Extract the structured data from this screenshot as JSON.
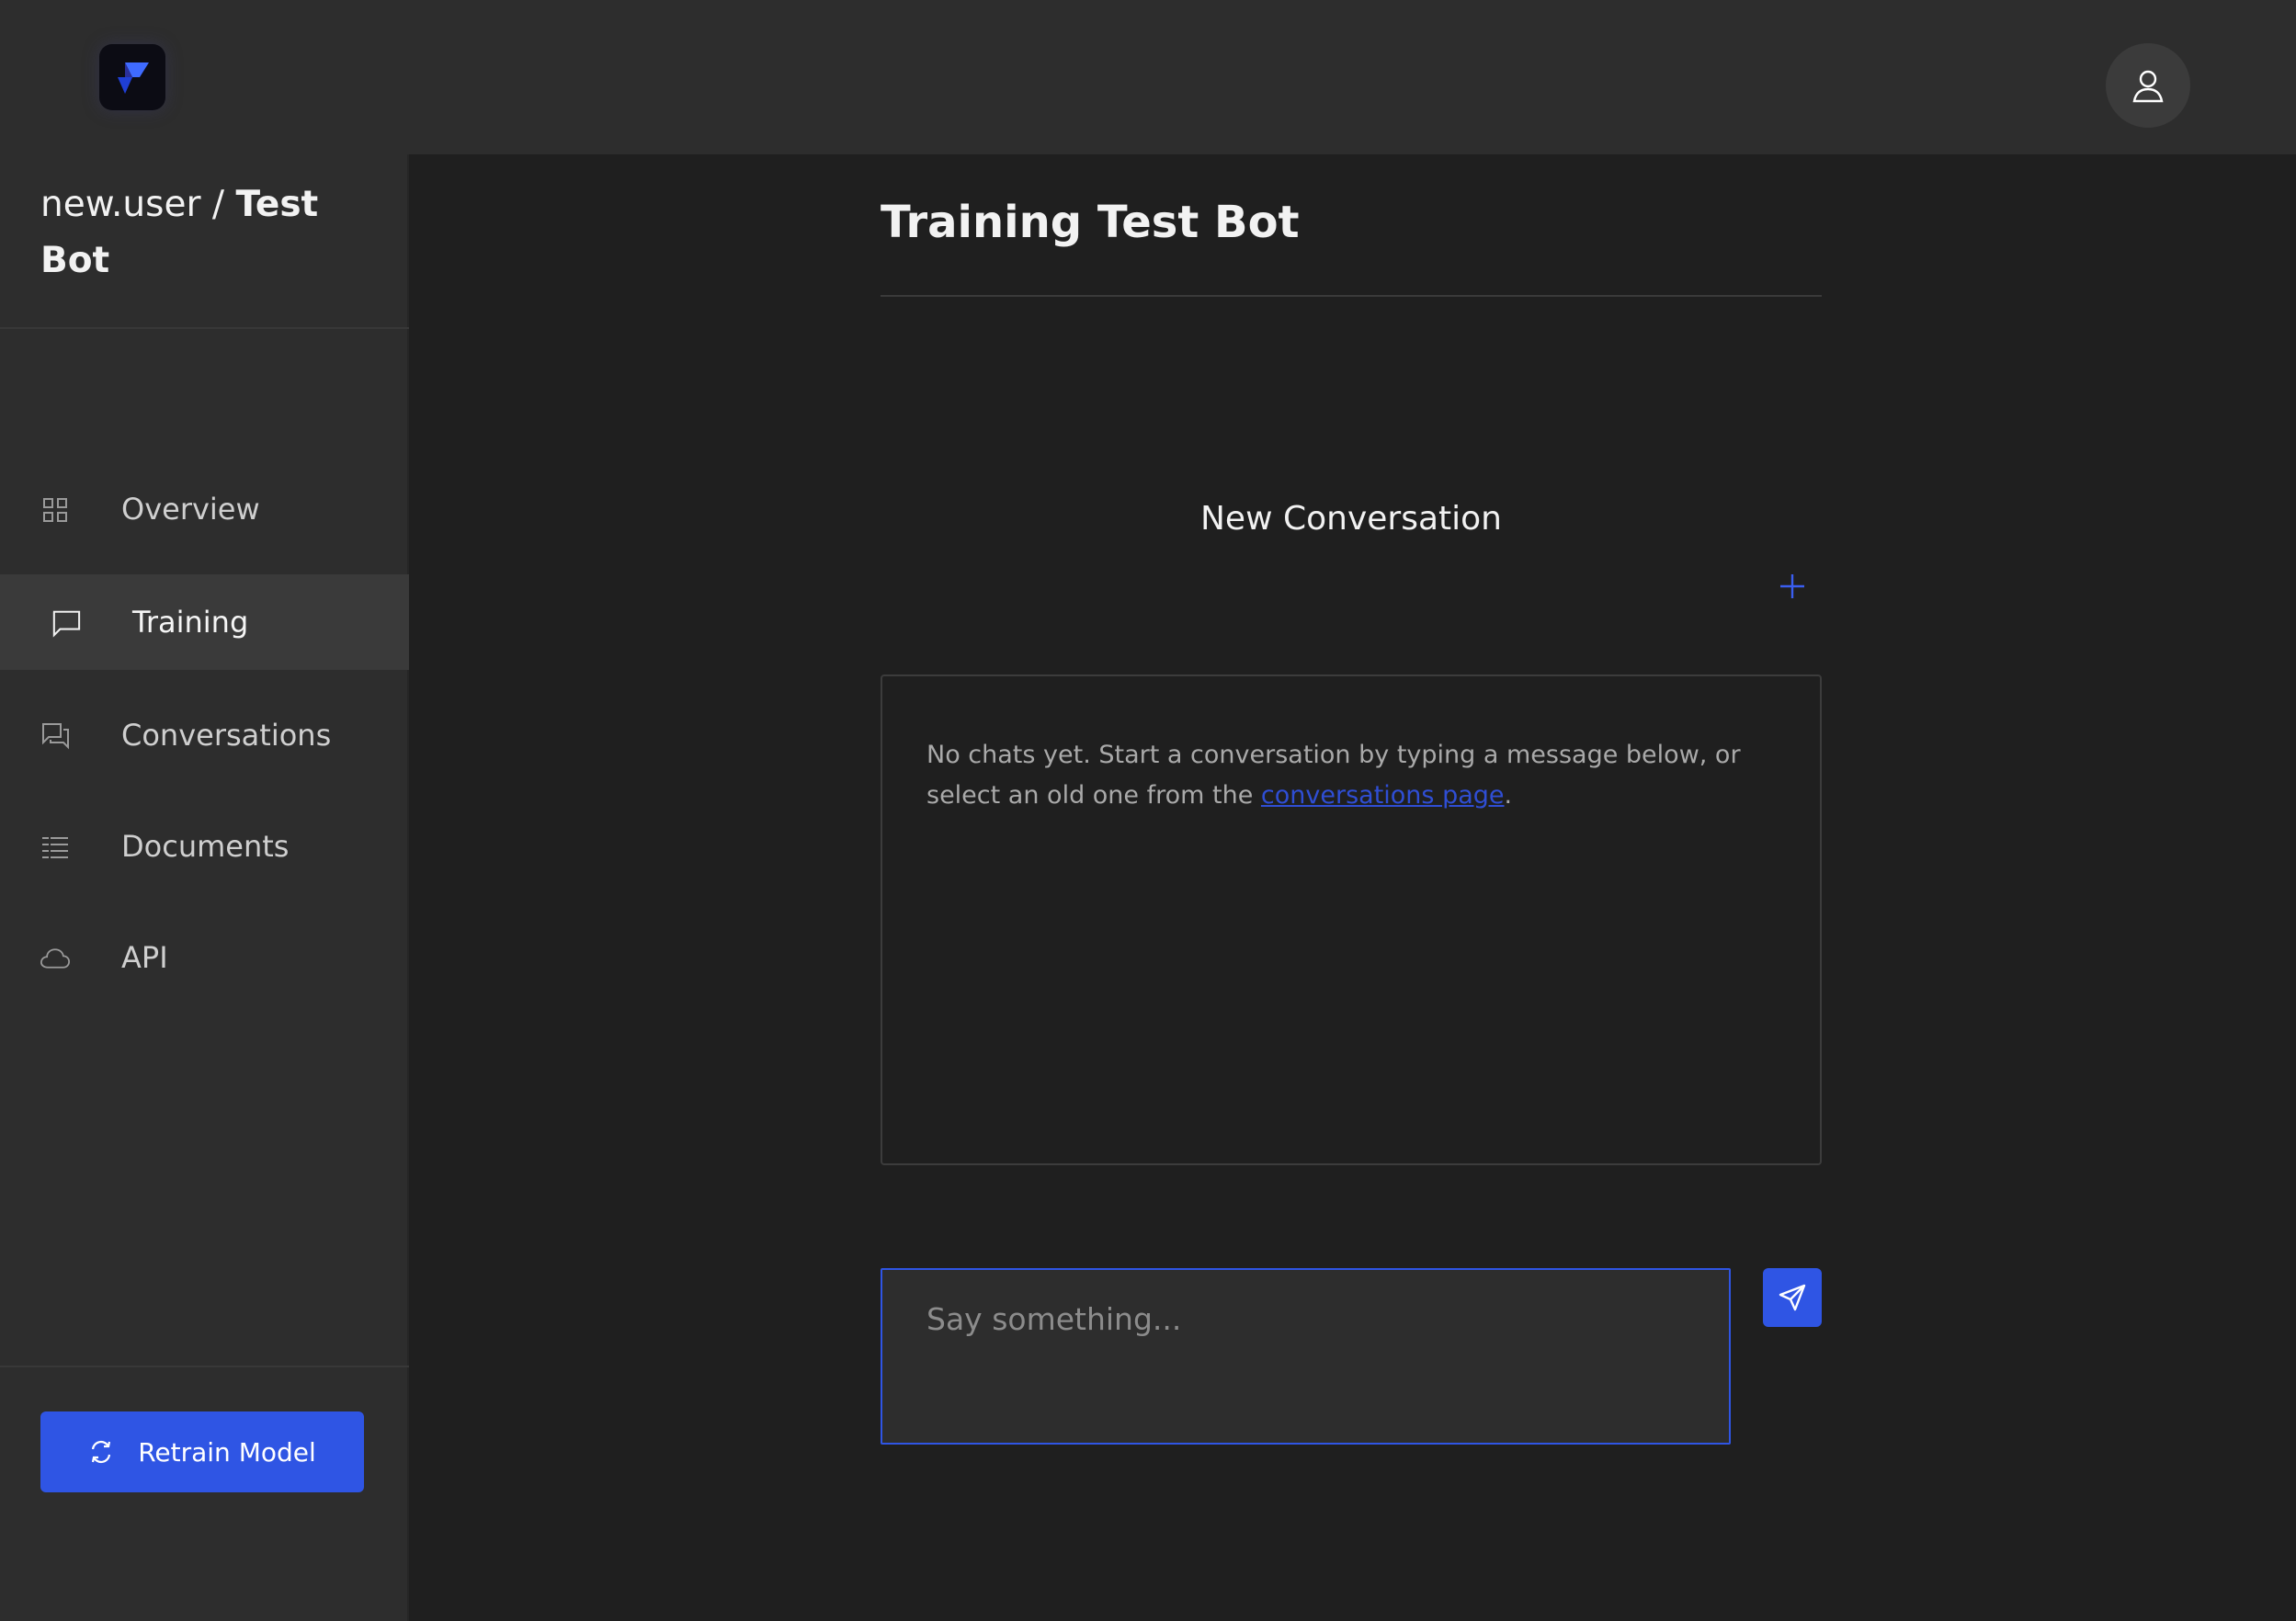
{
  "app": {
    "logo_icon": "app-logo-icon",
    "user_icon": "user-icon"
  },
  "breadcrumb": {
    "user": "new.user",
    "separator": "/",
    "bot": "Test Bot"
  },
  "sidebar": {
    "items": [
      {
        "label": "Overview",
        "icon": "grid-icon",
        "active": false
      },
      {
        "label": "Training",
        "icon": "chat-bubble-icon",
        "active": true
      },
      {
        "label": "Conversations",
        "icon": "conversations-icon",
        "active": false
      },
      {
        "label": "Documents",
        "icon": "documents-list-icon",
        "active": false
      },
      {
        "label": "API",
        "icon": "cloud-icon",
        "active": false
      }
    ],
    "retrain_label": "Retrain Model",
    "retrain_icon": "refresh-icon"
  },
  "main": {
    "title": "Training Test Bot",
    "conversation_heading": "New Conversation",
    "new_conversation_icon": "plus-icon",
    "empty_text": "No chats yet. Start a conversation by typing a message below, or select an old one from the ",
    "empty_link": "conversations page",
    "empty_suffix": ".",
    "input_value": "",
    "input_placeholder": "Say something...",
    "send_icon": "send-icon"
  },
  "colors": {
    "accent": "#2f55e4",
    "link": "#2f4ed4",
    "background": "#1f1f1f",
    "panel": "#2d2d2d",
    "active_item": "#3a3a3a"
  }
}
